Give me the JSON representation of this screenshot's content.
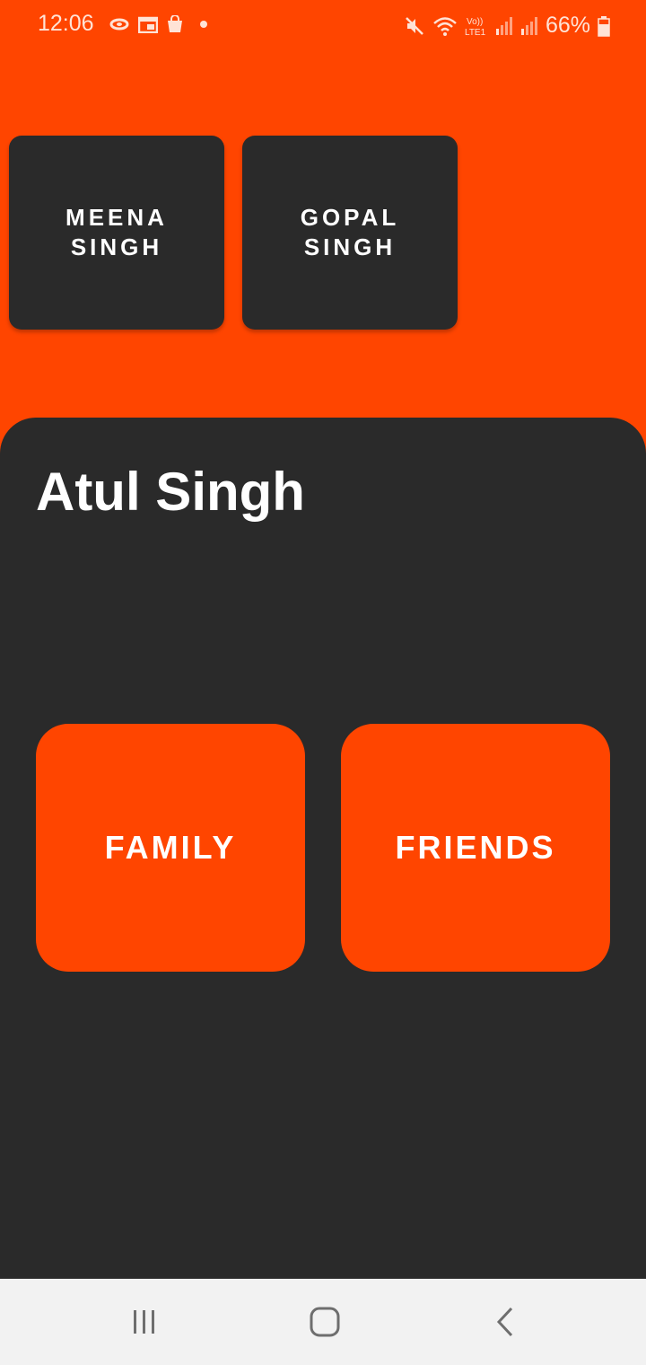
{
  "status": {
    "time": "12:06",
    "battery": "66%",
    "icons_left": [
      "swirl-icon",
      "calendar-icon",
      "bag-icon",
      "dot-icon"
    ],
    "icons_right": [
      "mute-icon",
      "wifi-icon",
      "volte-icon",
      "signal-icon",
      "signal-icon",
      "battery-icon"
    ],
    "volte_label": "Vo))\nLTE1"
  },
  "contacts": [
    {
      "label": "MEENA\nSINGH"
    },
    {
      "label": "GOPAL\nSINGH"
    }
  ],
  "profile": {
    "name": "Atul Singh"
  },
  "groups": [
    {
      "label": "FAMILY"
    },
    {
      "label": "FRIENDS"
    }
  ],
  "nav": [
    "recents-icon",
    "home-icon",
    "back-icon"
  ],
  "colors": {
    "accent": "#ff4500",
    "surface": "#2a2a2a",
    "nav": "#f2f2f2"
  }
}
